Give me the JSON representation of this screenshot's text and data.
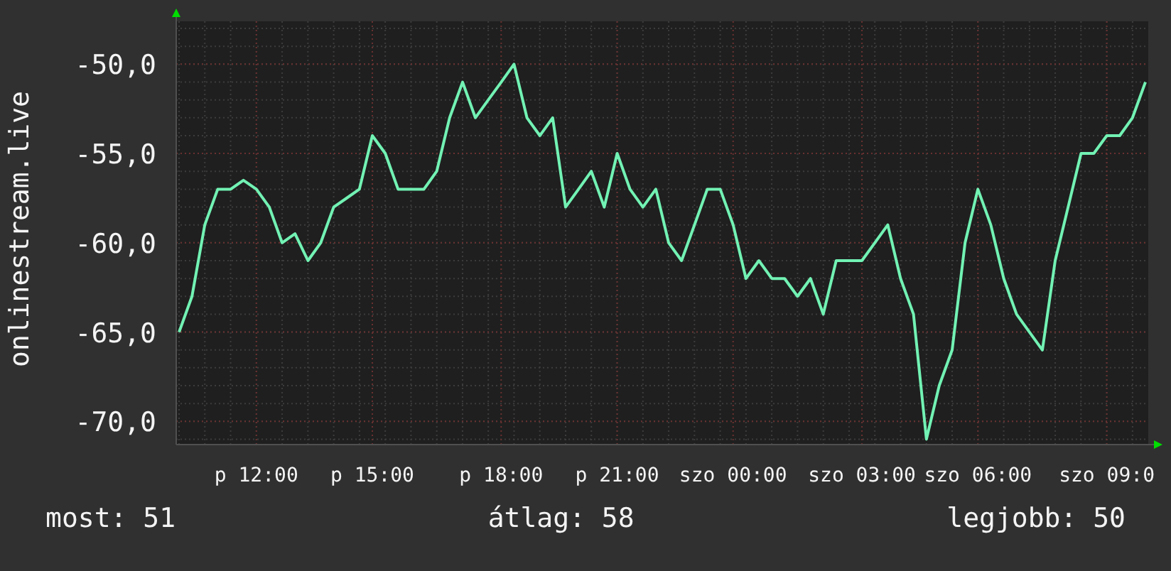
{
  "chart_data": {
    "type": "line",
    "grid": true,
    "ylabel": "onlinestream.live",
    "categories": [
      null,
      null,
      null,
      null,
      null,
      null,
      "p 12:00",
      null,
      null,
      null,
      null,
      null,
      null,
      null,
      null,
      "p 15:00",
      null,
      null,
      null,
      null,
      null,
      null,
      null,
      null,
      null,
      "p 18:00",
      null,
      null,
      null,
      null,
      null,
      null,
      null,
      null,
      "p 21:00",
      null,
      null,
      null,
      null,
      null,
      null,
      null,
      null,
      "szo 00:00",
      null,
      null,
      null,
      null,
      null,
      null,
      null,
      null,
      null,
      "szo 03:00",
      null,
      null,
      null,
      null,
      null,
      null,
      null,
      null,
      "szo 06:00",
      null,
      null,
      null,
      null,
      null,
      null,
      null,
      null,
      null,
      "szo 09:0",
      null,
      null,
      null
    ],
    "series": [
      {
        "color": "#72f2b4",
        "values": [
          -65,
          -63,
          -59,
          -57,
          -57,
          -56.5,
          -57,
          -58,
          -60,
          -59.5,
          -61,
          -60,
          -58,
          -57.5,
          -57,
          -54,
          -55,
          -57,
          -57,
          -57,
          -56,
          -53,
          -51,
          -53,
          -52,
          -51,
          -50,
          -53,
          -54,
          -53,
          -58,
          -57,
          -56,
          -58,
          -55,
          -57,
          -58,
          -57,
          -60,
          -61,
          -59,
          -57,
          -57,
          -59,
          -62,
          -61,
          -62,
          -62,
          -63,
          -62,
          -64,
          -61,
          -61,
          -61,
          -60,
          -59,
          -62,
          -64,
          -71,
          -68,
          -66,
          -60,
          -57,
          -59,
          -62,
          -64,
          -65,
          -66,
          -61,
          -58,
          -55,
          -55,
          -54,
          -54,
          -53,
          -51
        ]
      }
    ],
    "ylim": [
      -71.3,
      -47.6
    ],
    "yticks": [
      {
        "value": -50,
        "label": "-50,0"
      },
      {
        "value": -55,
        "label": "-55,0"
      },
      {
        "value": -60,
        "label": "-60,0"
      },
      {
        "value": -65,
        "label": "-65,0"
      },
      {
        "value": -70,
        "label": "-70,0"
      }
    ]
  },
  "legend": [
    "most: 51",
    "átlag: 58",
    "legjobb: 50"
  ]
}
